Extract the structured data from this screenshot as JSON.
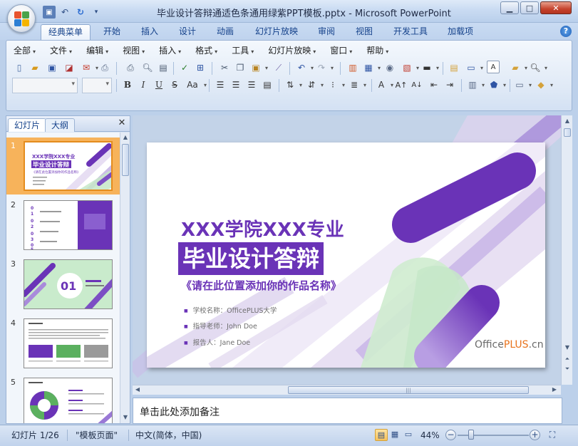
{
  "window": {
    "title": "毕业设计答辩通适色条通用绿紫PPT模板.pptx - Microsoft PowerPoint"
  },
  "qat": {
    "icons": [
      "save-icon",
      "undo-icon",
      "redo-icon",
      "customize-icon"
    ]
  },
  "window_controls": {
    "minimize": "▁",
    "maximize": "□",
    "close": "✕"
  },
  "ribbon_tabs": [
    "经典菜单",
    "开始",
    "插入",
    "设计",
    "动画",
    "幻灯片放映",
    "审阅",
    "视图",
    "开发工具",
    "加载项"
  ],
  "active_tab": "经典菜单",
  "help_label": "?",
  "menus": [
    "全部",
    "文件",
    "编辑",
    "视图",
    "插入",
    "格式",
    "工具",
    "幻灯片放映",
    "窗口",
    "帮助"
  ],
  "left_panel": {
    "tabs": [
      "幻灯片",
      "大纲"
    ],
    "close_symbol": "✕"
  },
  "thumbnails": [
    {
      "number": "1",
      "selected": true,
      "title_line1": "XXX学院XXX专业",
      "title_line2": "毕业设计答辩",
      "subtitle": "《请在此位置添加你的作品名称》"
    },
    {
      "number": "2",
      "selected": false,
      "digits": [
        "0",
        "1",
        "0",
        "2",
        "0",
        "3",
        "0",
        "4",
        "0",
        "5"
      ]
    },
    {
      "number": "3",
      "selected": false,
      "big_number": "01"
    },
    {
      "number": "4",
      "selected": false
    },
    {
      "number": "5",
      "selected": false
    }
  ],
  "slide": {
    "title1": "XXX学院XXX专业",
    "title2": "毕业设计答辩",
    "subtitle": "《请在此位置添加你的作品名称》",
    "info": [
      "学校名称：OfficePLUS大学",
      "指导老师：John Doe",
      "报告人：Jane Doe"
    ],
    "brand_prefix": "Office",
    "brand_plus": "PLUS",
    "brand_suffix": ".cn",
    "colors": {
      "purple": "#6a33b7",
      "green": "#c5e8c8"
    }
  },
  "notes": {
    "placeholder": "单击此处添加备注"
  },
  "status": {
    "slide_info": "幻灯片 1/26",
    "theme": "\"模板页面\"",
    "language": "中文(简体，中国)",
    "zoom": "44%",
    "zoom_out": "−",
    "zoom_in": "+"
  }
}
